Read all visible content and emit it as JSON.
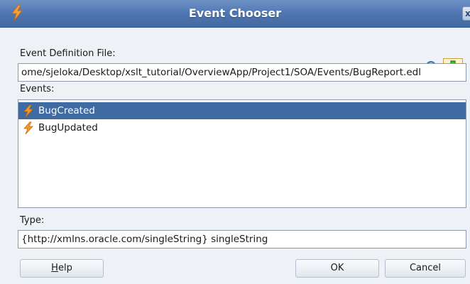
{
  "dialog": {
    "title": "Event Chooser",
    "close_glyph": "x"
  },
  "definition": {
    "label": "Event Definition File:",
    "path": "ome/sjeloka/Desktop/xslt_tutorial/OverviewApp/Project1/SOA/Events/BugReport.edl",
    "search_icon": "magnifier-icon",
    "add_icon": "green-plus-icon"
  },
  "events": {
    "label": "Events:",
    "items": [
      {
        "label": "BugCreated",
        "selected": true,
        "icon": "lightning-bolt-icon"
      },
      {
        "label": "BugUpdated",
        "selected": false,
        "icon": "lightning-bolt-icon"
      }
    ]
  },
  "type": {
    "label": "Type:",
    "value": "{http://xmlns.oracle.com/singleString} singleString"
  },
  "buttons": {
    "help_mnemonic": "H",
    "help_rest": "elp",
    "ok": "OK",
    "cancel": "Cancel"
  },
  "colors": {
    "titlebar": "#4f76b2",
    "selection": "#3f6aa2",
    "bolt": "#f08a1c"
  }
}
